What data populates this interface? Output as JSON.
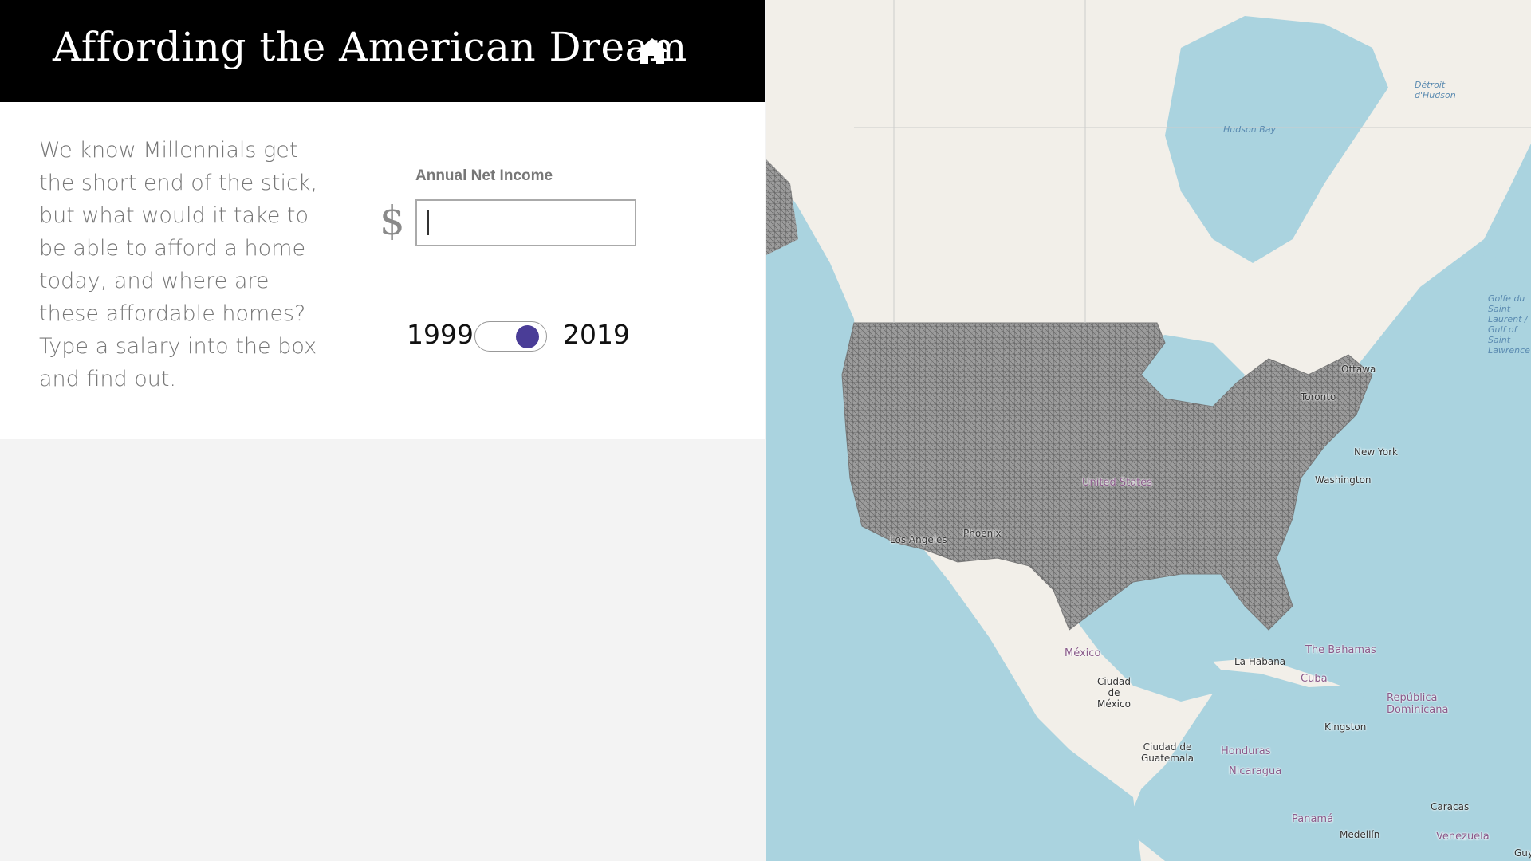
{
  "header": {
    "title": "Affording the American Dream",
    "home_icon": "home-icon"
  },
  "intro": {
    "text": "We know Millennials get the short end of the stick, but what would it take to be able to afford a home today, and where are these affordable homes? Type a salary into the box and find out."
  },
  "income": {
    "label": "Annual Net Income",
    "currency_symbol": "$",
    "value": "",
    "placeholder": ""
  },
  "year_toggle": {
    "start_label": "1999",
    "end_label": "2019",
    "selected": "2019",
    "accent_color": "#4a3d97"
  },
  "map": {
    "labels": {
      "hudson_bay": "Hudson Bay",
      "detroit_hudson": "Détroit d'Hudson",
      "golfe": "Golfe du Saint Laurent / Gulf of Saint Lawrence",
      "ottawa": "Ottawa",
      "toronto": "Toronto",
      "new_york": "New York",
      "washington": "Washington",
      "united_states": "United States",
      "phoenix": "Phoenix",
      "los_angeles": "Los Angeles",
      "mexico": "México",
      "mexico_city": "Ciudad de México",
      "la_habana": "La Habana",
      "the_bahamas": "The Bahamas",
      "cuba": "Cuba",
      "republica_dominicana": "República Dominicana",
      "kingston": "Kingston",
      "honduras": "Honduras",
      "guatemala_city": "Ciudad de Guatemala",
      "nicaragua": "Nicaragua",
      "panama": "Panamá",
      "caracas": "Caracas",
      "medellin": "Medellín",
      "venezuela": "Venezuela",
      "guy": "Guy"
    },
    "colors": {
      "water": "#aad3df",
      "land": "#f2efe9",
      "usa_fill": "#9a9a9a"
    }
  }
}
